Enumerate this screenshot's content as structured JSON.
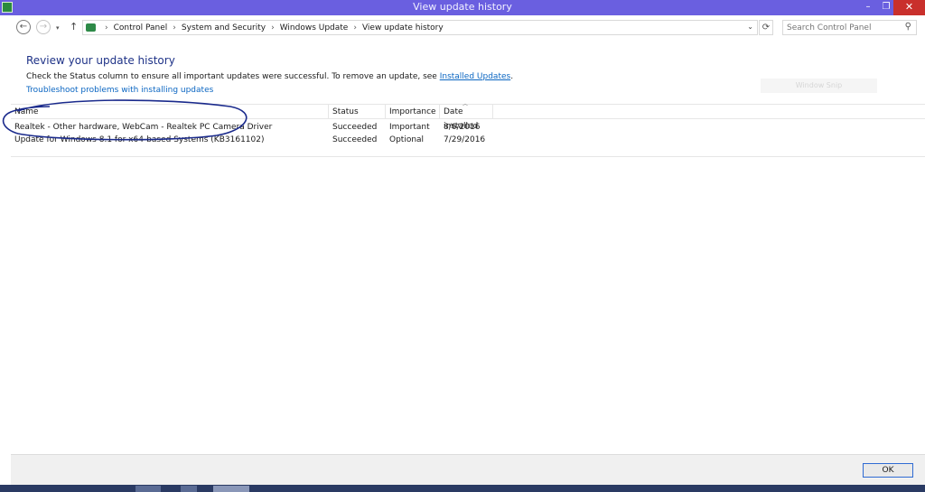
{
  "window": {
    "title": "View update history",
    "minimize_glyph": "–",
    "maximize_glyph": "❐",
    "close_glyph": "✕"
  },
  "address_bar": {
    "back_glyph": "←",
    "forward_glyph": "→",
    "recent_glyph": "▾",
    "up_glyph": "↑",
    "refresh_glyph": "⟳",
    "dropdown_glyph": "⌄",
    "breadcrumbs": [
      "Control Panel",
      "System and Security",
      "Windows Update",
      "View update history"
    ],
    "separator": "›"
  },
  "search": {
    "placeholder": "Search Control Panel",
    "icon_glyph": "⚲"
  },
  "main": {
    "heading": "Review your update history",
    "description": "Check the Status column to ensure all important updates were successful. To remove an update, see ",
    "installed_updates_link": "Installed Updates",
    "description_end": ".",
    "troubleshoot_link": "Troubleshoot problems with installing updates",
    "ghost_button": "Window Snip"
  },
  "table": {
    "columns": [
      "Name",
      "Status",
      "Importance",
      "Date installed"
    ],
    "rows": [
      [
        "Realtek - Other hardware, WebCam - Realtek PC Camera Driver",
        "Succeeded",
        "Important",
        "8/6/2016"
      ],
      [
        "Update for Windows 8.1 for x64-based Systems (KB3161102)",
        "Succeeded",
        "Optional",
        "7/29/2016"
      ]
    ]
  },
  "footer": {
    "ok_label": "OK"
  },
  "colors": {
    "titlebar": "#6a5fe0",
    "link": "#0b66c2",
    "heading": "#1e3287",
    "annotation": "#1a2a8c"
  }
}
